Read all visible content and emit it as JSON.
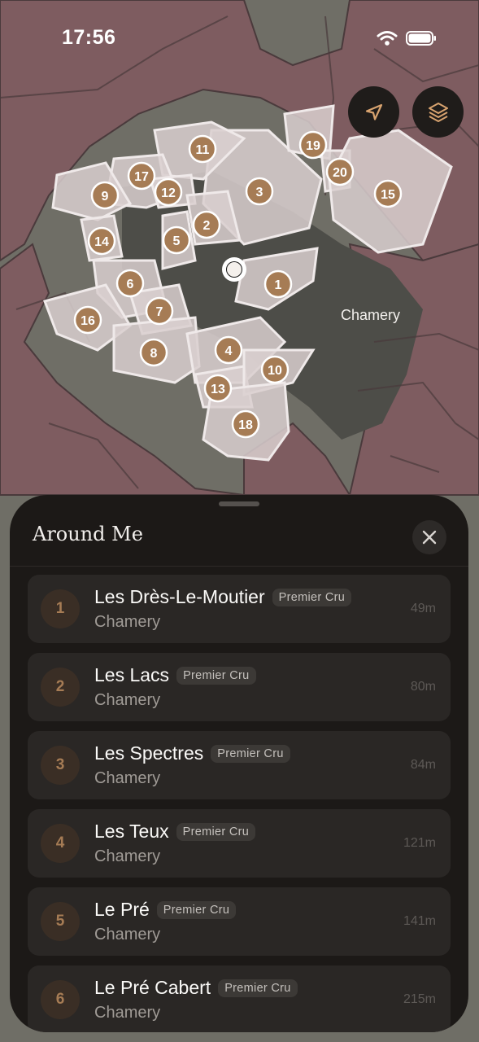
{
  "status_bar": {
    "time": "17:56"
  },
  "map": {
    "place_label": "Chamery",
    "markers": [
      "1",
      "2",
      "3",
      "4",
      "5",
      "6",
      "7",
      "8",
      "9",
      "10",
      "11",
      "12",
      "13",
      "14",
      "15",
      "16",
      "17",
      "18",
      "19",
      "20"
    ]
  },
  "controls": {
    "locate_icon": "location-arrow-icon",
    "layers_icon": "layers-icon"
  },
  "sheet": {
    "title": "Around Me",
    "items": [
      {
        "num": "1",
        "name": "Les Drès-Le-Moutier",
        "badge": "Premier Cru",
        "village": "Chamery",
        "distance": "49m"
      },
      {
        "num": "2",
        "name": "Les Lacs",
        "badge": "Premier Cru",
        "village": "Chamery",
        "distance": "80m"
      },
      {
        "num": "3",
        "name": "Les Spectres",
        "badge": "Premier Cru",
        "village": "Chamery",
        "distance": "84m"
      },
      {
        "num": "4",
        "name": "Les Teux",
        "badge": "Premier Cru",
        "village": "Chamery",
        "distance": "121m"
      },
      {
        "num": "5",
        "name": "Le Pré",
        "badge": "Premier Cru",
        "village": "Chamery",
        "distance": "141m"
      },
      {
        "num": "6",
        "name": "Le Pré Cabert",
        "badge": "Premier Cru",
        "village": "Chamery",
        "distance": "215m"
      }
    ]
  },
  "colors": {
    "marker": "#a67c55",
    "parcel": "#d9cfcf",
    "vineyard": "#7d5a5e",
    "sheet_bg": "#1c1917"
  }
}
